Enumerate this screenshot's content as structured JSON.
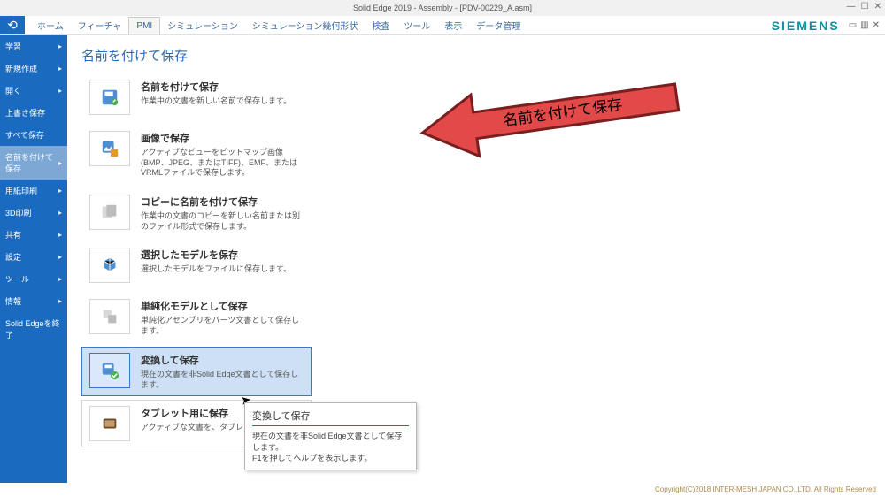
{
  "window_title": "Solid Edge 2019 - Assembly - [PDV-00229_A.asm]",
  "brand": "SIEMENS",
  "ribbon_tabs": [
    "ホーム",
    "フィーチャ",
    "PMI",
    "シミュレーション",
    "シミュレーション幾何形状",
    "検査",
    "ツール",
    "表示",
    "データ管理"
  ],
  "active_tab_index": 2,
  "sidebar": {
    "items": [
      {
        "label": "学習",
        "chev": true
      },
      {
        "label": "新規作成",
        "chev": true
      },
      {
        "label": "開く",
        "chev": true
      },
      {
        "label": "上書き保存",
        "chev": false
      },
      {
        "label": "すべて保存",
        "chev": false
      },
      {
        "label": "名前を付けて保存",
        "chev": true,
        "selected": true
      },
      {
        "label": "用紙印刷",
        "chev": true
      },
      {
        "label": "3D印刷",
        "chev": true
      },
      {
        "label": "共有",
        "chev": true
      },
      {
        "label": "設定",
        "chev": true
      },
      {
        "label": "ツール",
        "chev": true
      },
      {
        "label": "情報",
        "chev": true
      },
      {
        "label": "Solid Edgeを終了",
        "chev": false
      }
    ]
  },
  "page_title": "名前を付けて保存",
  "options": [
    {
      "title": "名前を付けて保存",
      "desc": "作業中の文書を新しい名前で保存します。"
    },
    {
      "title": "画像で保存",
      "desc": "アクティブなビューをビットマップ画像(BMP、JPEG、またはTIFF)、EMF、またはVRMLファイルで保存します。"
    },
    {
      "title": "コピーに名前を付けて保存",
      "desc": "作業中の文書のコピーを新しい名前または別のファイル形式で保存します。"
    },
    {
      "title": "選択したモデルを保存",
      "desc": "選択したモデルをファイルに保存します。"
    },
    {
      "title": "単純化モデルとして保存",
      "desc": "単純化アセンブリをパーツ文書として保存します。"
    },
    {
      "title": "変換して保存",
      "desc": "現在の文書を非Solid Edge文書として保存します。",
      "selected": true
    },
    {
      "title": "タブレット用に保存",
      "desc": "アクティブな文書を、タブレット デバイス"
    }
  ],
  "tooltip": {
    "title": "変換して保存",
    "line1": "現在の文書を非Solid Edge文書として保存します。",
    "line2": "F1を押してヘルプを表示します。"
  },
  "callout_text": "名前を付けて保存",
  "footer": "Copyright(C)2018 INTER-MESH JAPAN CO.,LTD.  All Rights Reserved",
  "colors": {
    "siemens_teal": "#0c91a0",
    "primary_blue": "#1a6bbf",
    "callout_red": "#e24a4a"
  }
}
